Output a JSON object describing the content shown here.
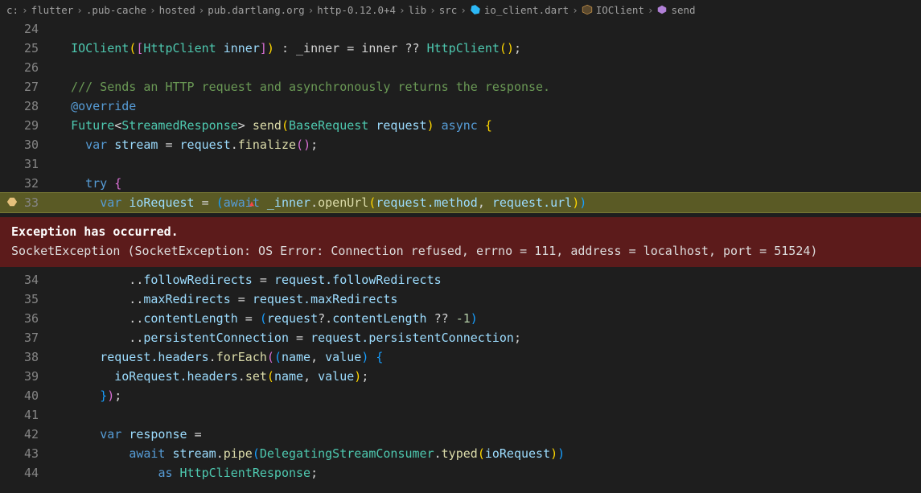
{
  "breadcrumb": {
    "items": [
      {
        "label": "c:",
        "icon": ""
      },
      {
        "label": "flutter"
      },
      {
        "label": ".pub-cache"
      },
      {
        "label": "hosted"
      },
      {
        "label": "pub.dartlang.org"
      },
      {
        "label": "http-0.12.0+4"
      },
      {
        "label": "lib"
      },
      {
        "label": "src"
      },
      {
        "label": "io_client.dart",
        "icon": "dart-file-icon"
      },
      {
        "label": "IOClient",
        "icon": "class-icon"
      },
      {
        "label": "send",
        "icon": "method-icon"
      }
    ],
    "sep": "›"
  },
  "code_lines": {
    "24": "",
    "25_pre": "  ",
    "25_cls": "IOClient",
    "25_b1o": "(",
    "25_b2o": "[",
    "25_httpc": "HttpClient",
    "25_sp": " ",
    "25_inner": "inner",
    "25_b2c": "]",
    "25_b1c": ")",
    "25_rest": " : _inner = inner ?? ",
    "25_httpc2": "HttpClient",
    "25_b3o": "(",
    "25_b3c": ")",
    "25_semi": ";",
    "26": "",
    "27": "  /// Sends an HTTP request and asynchronously returns the response.",
    "28_pre": "  ",
    "28_at": "@override",
    "29_pre": "  ",
    "29_fut": "Future",
    "29_lt": "<",
    "29_sr": "StreamedResponse",
    "29_gt": ">",
    "29_sp": " ",
    "29_send": "send",
    "29_b1o": "(",
    "29_br": "BaseRequest",
    "29_sp2": " ",
    "29_req": "request",
    "29_b1c": ")",
    "29_sp3": " ",
    "29_async": "async",
    "29_sp4": " ",
    "29_brk": "{",
    "30_pre": "    ",
    "30_var": "var",
    "30_sp": " ",
    "30_stream": "stream",
    "30_eq": " = ",
    "30_req": "request",
    "30_dot": ".",
    "30_fin": "finalize",
    "30_bo": "(",
    "30_bc": ")",
    "30_semi": ";",
    "31": "",
    "32_pre": "    ",
    "32_try": "try",
    "32_sp": " ",
    "32_brk": "{",
    "33_pre": "      ",
    "33_var": "var",
    "33_sp": " ",
    "33_ior": "ioRequest",
    "33_eq": " = ",
    "33_b1o": "(",
    "33_await": "await",
    "33_sp2": " ",
    "33_inner": "_inner",
    "33_dot": ".",
    "33_open": "openUrl",
    "33_b2o": "(",
    "33_reqm": "request.method",
    "33_comma": ", ",
    "33_requ": "request.url",
    "33_b2c": ")",
    "33_b1c": ")",
    "34_pre": "          ..",
    "34_fr": "followRedirects",
    "34_eq": " = ",
    "34_rfr": "request.followRedirects",
    "35_pre": "          ..",
    "35_mr": "maxRedirects",
    "35_eq": " = ",
    "35_rmr": "request.maxRedirects",
    "36_pre": "          ..",
    "36_cl": "contentLength",
    "36_eq": " = ",
    "36_bo": "(",
    "36_rq": "request",
    "36_qdot": "?.",
    "36_cl2": "contentLength",
    "36_qq": " ?? ",
    "36_neg1": "-1",
    "36_bc": ")",
    "37_pre": "          ..",
    "37_pc": "persistentConnection",
    "37_eq": " = ",
    "37_rpc": "request.persistentConnection",
    "37_semi": ";",
    "38_pre": "      ",
    "38_rh": "request.headers",
    "38_dot": ".",
    "38_fe": "forEach",
    "38_b1o": "(",
    "38_b2o": "(",
    "38_name": "name",
    "38_c": ", ",
    "38_val": "value",
    "38_b2c": ")",
    "38_sp": " ",
    "38_brk": "{",
    "39_pre": "        ",
    "39_ior": "ioRequest.headers",
    "39_dot": ".",
    "39_set": "set",
    "39_bo": "(",
    "39_name": "name",
    "39_c": ", ",
    "39_val": "value",
    "39_bc": ")",
    "39_semi": ";",
    "40_pre": "      ",
    "40_brk": "}",
    "40_bc": ")",
    "40_semi": ";",
    "41": "",
    "42_pre": "      ",
    "42_var": "var",
    "42_sp": " ",
    "42_resp": "response",
    "42_eq": " =",
    "43_pre": "          ",
    "43_await": "await",
    "43_sp": " ",
    "43_stream": "stream",
    "43_dot": ".",
    "43_pipe": "pipe",
    "43_b1o": "(",
    "43_dsc": "DelegatingStreamConsumer",
    "43_dot2": ".",
    "43_typed": "typed",
    "43_b2o": "(",
    "43_ior": "ioRequest",
    "43_b2c": ")",
    "43_b1c": ")",
    "44_pre": "              ",
    "44_as": "as",
    "44_sp": " ",
    "44_hcr": "HttpClientResponse",
    "44_semi": ";"
  },
  "exception": {
    "title": "Exception has occurred.",
    "message": "SocketException (SocketException: OS Error: Connection refused, errno = 111, address = localhost, port = 51524)"
  }
}
